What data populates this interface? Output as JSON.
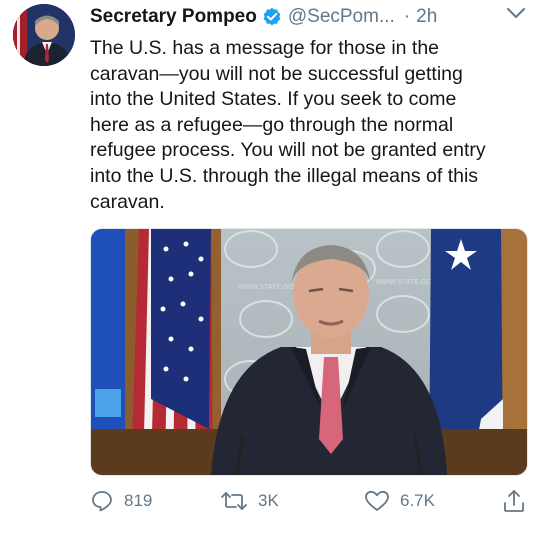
{
  "tweet": {
    "author_name": "Secretary Pompeo",
    "handle": "@SecPom...",
    "separator": "·",
    "time": "2h",
    "text_lines": [
      "The U.S. has a message for those in the",
      "caravan—you will not be successful getting",
      "into the United States. If you seek to come",
      "here as a refugee—go through the normal",
      "refugee process. You will not be granted entry",
      "into the U.S. through the illegal means of this",
      "caravan."
    ],
    "media": {
      "watermark_text": "WWW.STATE.GOV"
    },
    "actions": {
      "replies": "819",
      "retweets": "3K",
      "likes": "6.7K"
    }
  },
  "colors": {
    "text": "#14171a",
    "secondary": "#657786",
    "verified": "#1da1f2"
  },
  "icons": {
    "verified": "verified-badge-icon",
    "menu": "chevron-down-icon",
    "reply": "reply-icon",
    "retweet": "retweet-icon",
    "like": "heart-icon",
    "share": "share-icon"
  }
}
